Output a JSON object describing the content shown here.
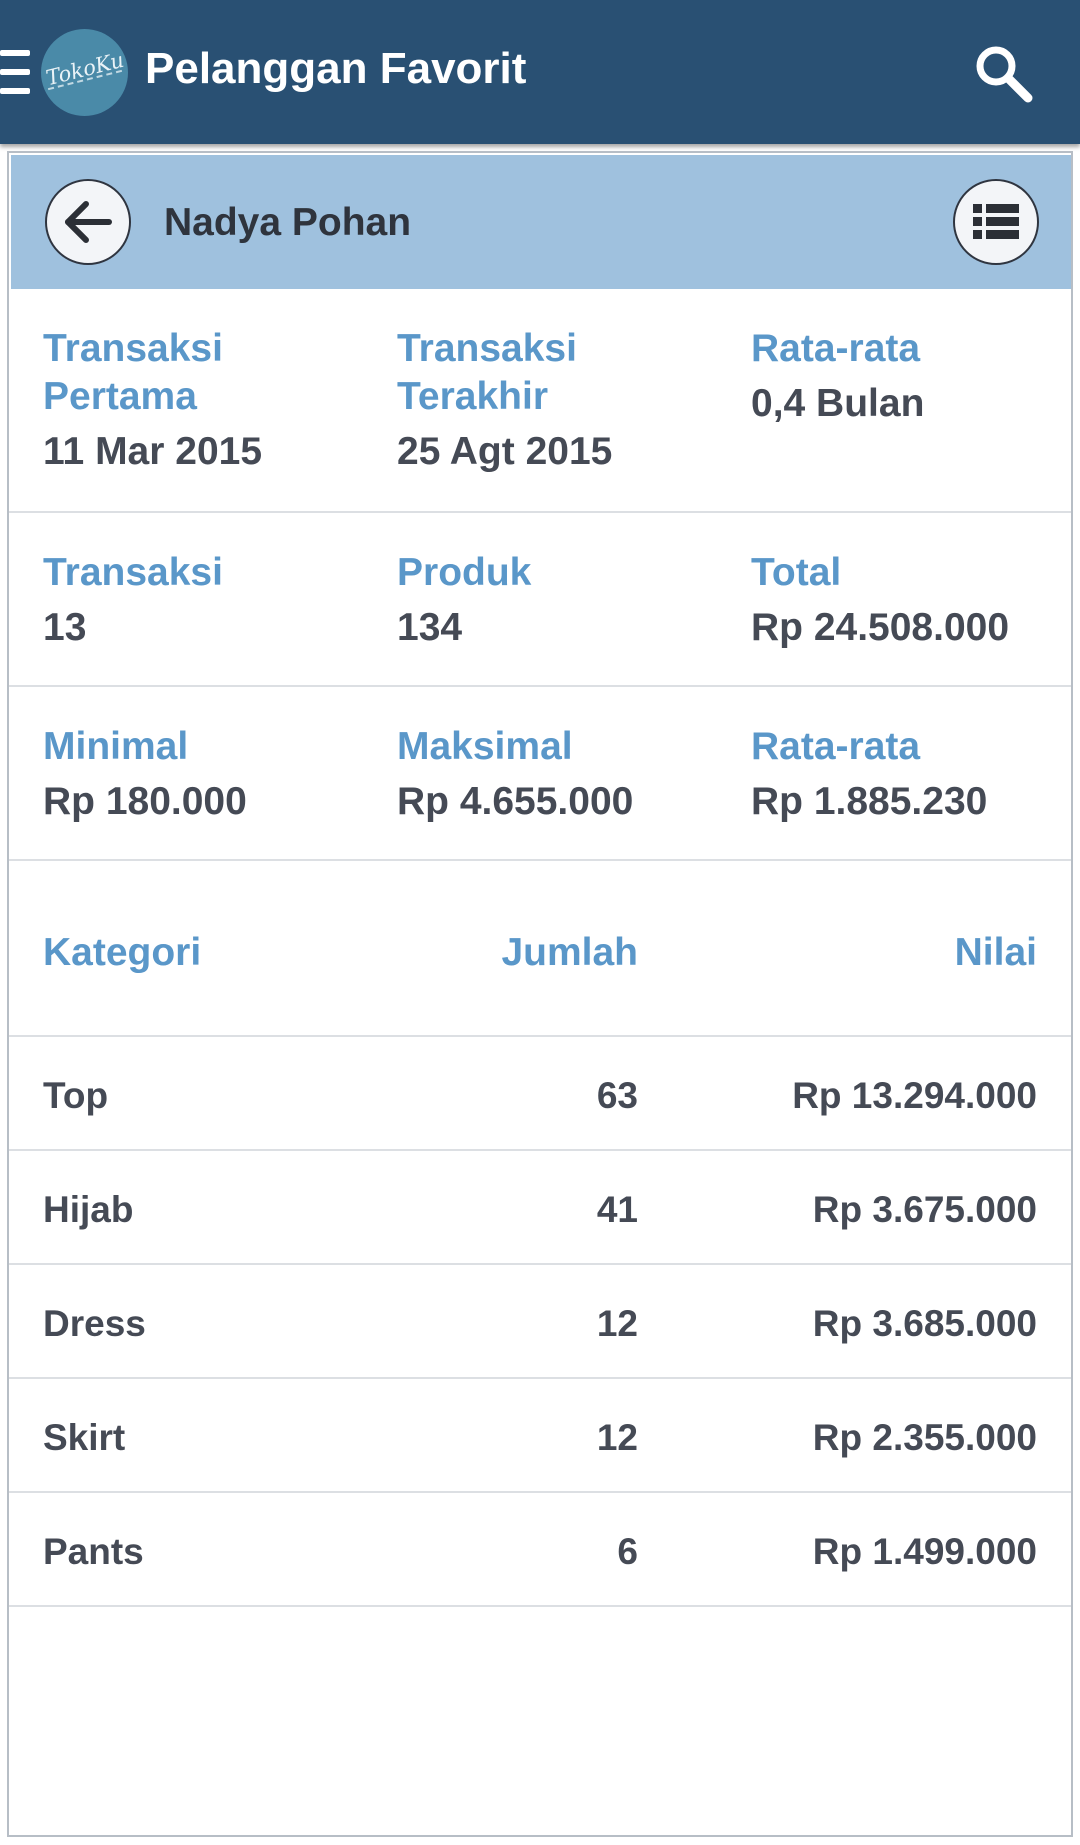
{
  "app": {
    "title": "Pelanggan Favorit",
    "logo_text": "TokoKu"
  },
  "detail": {
    "customer_name": "Nadya Pohan"
  },
  "stats": {
    "rows": [
      [
        {
          "label": "Transaksi Pertama",
          "value": "11 Mar 2015"
        },
        {
          "label": "Transaksi Terakhir",
          "value": "25 Agt 2015"
        },
        {
          "label": "Rata-rata",
          "value": "0,4 Bulan"
        }
      ],
      [
        {
          "label": "Transaksi",
          "value": "13"
        },
        {
          "label": "Produk",
          "value": "134"
        },
        {
          "label": "Total",
          "value": "Rp 24.508.000"
        }
      ],
      [
        {
          "label": "Minimal",
          "value": "Rp 180.000"
        },
        {
          "label": "Maksimal",
          "value": "Rp 4.655.000"
        },
        {
          "label": "Rata-rata",
          "value": "Rp 1.885.230"
        }
      ]
    ]
  },
  "table": {
    "columns": [
      "Kategori",
      "Jumlah",
      "Nilai"
    ],
    "rows": [
      [
        "Top",
        "63",
        "Rp 13.294.000"
      ],
      [
        "Hijab",
        "41",
        "Rp 3.675.000"
      ],
      [
        "Dress",
        "12",
        "Rp 3.685.000"
      ],
      [
        "Skirt",
        "12",
        "Rp 2.355.000"
      ],
      [
        "Pants",
        "6",
        "Rp 1.499.000"
      ]
    ]
  },
  "colors": {
    "appbar": "#295073",
    "header_band": "#9fc1de",
    "label_blue": "#5a97c9",
    "value_text": "#454a55"
  },
  "icons": [
    "menu-icon",
    "search-icon",
    "back-arrow-icon",
    "list-icon"
  ]
}
